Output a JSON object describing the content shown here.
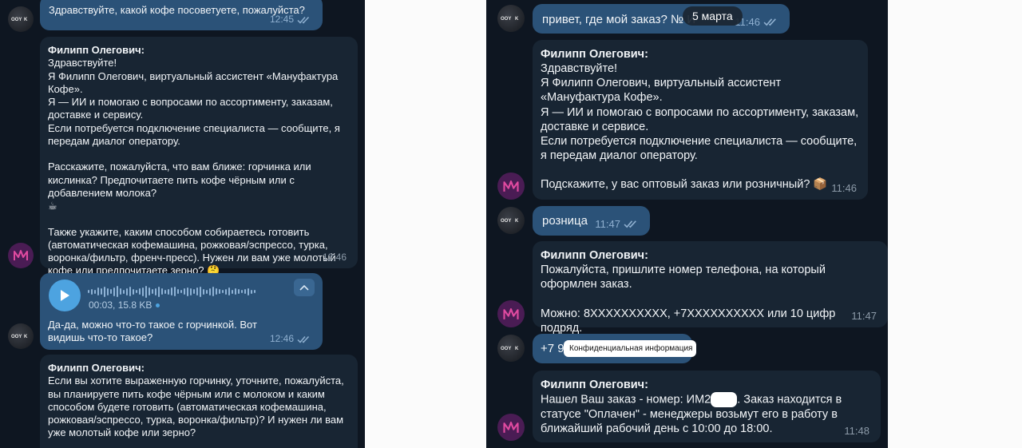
{
  "left": {
    "msg1": {
      "text": "Здравствуйте, какой кофе посоветуете, пожалуйста?",
      "time": "12:45"
    },
    "msg2": {
      "sender": "Филипп Олегович:",
      "text": "Здравствуйте!\nЯ Филипп Олегович, виртуальный ассистент «Мануфактура Кофе».\nЯ — ИИ и помогаю с вопросами по ассортименту, заказам, доставке и сервису.\nЕсли потребуется подключение специалиста — сообщите, я передам диалог оператору.\n\nРасскажите, пожалуйста, что вам ближе: горчинка или кислинка? Предпочитаете пить кофе чёрным или с добавлением молока?\n☕\n\nТакже укажите, каким способом собираетесь готовить (автоматическая кофемашина, рожковая/эспрессо, турка, воронка/фильтр, френч-пресс). Нужен ли вам уже молотый кофе или предпочитаете зерно? 🤔",
      "time": "12:46"
    },
    "msg3": {
      "voice_meta": "00:03, 15.8 KB",
      "text": "Да-да, можно что-то такое с горчинкой. Вот видишь что-то такое?",
      "time": "12:46"
    },
    "msg4": {
      "sender": "Филипп Олегович:",
      "text": "Если вы хотите выраженную горчинку, уточните, пожалуйста, вы планируете пить кофе чёрным или с молоком и каким способом будете готовить (автоматическая кофемашина, рожковая/эспрессо, турка, воронка/фильтр)? И нужен ли вам уже молотый кофе или зерно?"
    }
  },
  "right": {
    "date_badge": "5 марта",
    "msg1": {
      "text": "привет, где мой заказ? № И",
      "time": "11:46"
    },
    "msg2": {
      "sender": "Филипп Олегович:",
      "text": "Здравствуйте!\nЯ Филипп Олегович, виртуальный ассистент «Мануфактура Кофе».\nЯ — ИИ и помогаю с вопросами по ассортименту, заказам, доставке и сервисе.\nЕсли потребуется подключение специалиста — сообщите, я передам диалог оператору.\n\nПодскажите, у вас оптовый заказ или розничный? 📦",
      "time": "11:46"
    },
    "msg3": {
      "text": "розница",
      "time": "11:47"
    },
    "msg4": {
      "sender": "Филипп Олегович:",
      "text": "Пожалуйста, пришлите номер телефона, на который оформлен заказ.\n\nМожно: 8XXXXXXXXXX, +7XXXXXXXXXX или 10 цифр подряд.",
      "time": "11:47"
    },
    "msg5": {
      "text_prefix": "+7 9",
      "redaction_label": "Конфиденциальная информация"
    },
    "msg6": {
      "sender": "Филипп Олегович:",
      "text_before": "Нашел Ваш заказ - номер: ИМ2",
      "text_after": ". Заказ находится в статусе \"Оплачен\" - менеджеры возьмут его в работу в ближайший рабочий день с 10:00 до 18:00.",
      "time": "11:48"
    }
  },
  "icons": {
    "read": "double-check-icon",
    "play": "play-icon",
    "collapse": "chevron-up-icon",
    "bot_avatar": "crown-logo-icon"
  },
  "colors": {
    "panel_bg": "#0e1621",
    "incoming": "#182533",
    "outgoing": "#2b5278",
    "accent": "#4da3e0",
    "bot_avatar": "#4a1c54"
  }
}
